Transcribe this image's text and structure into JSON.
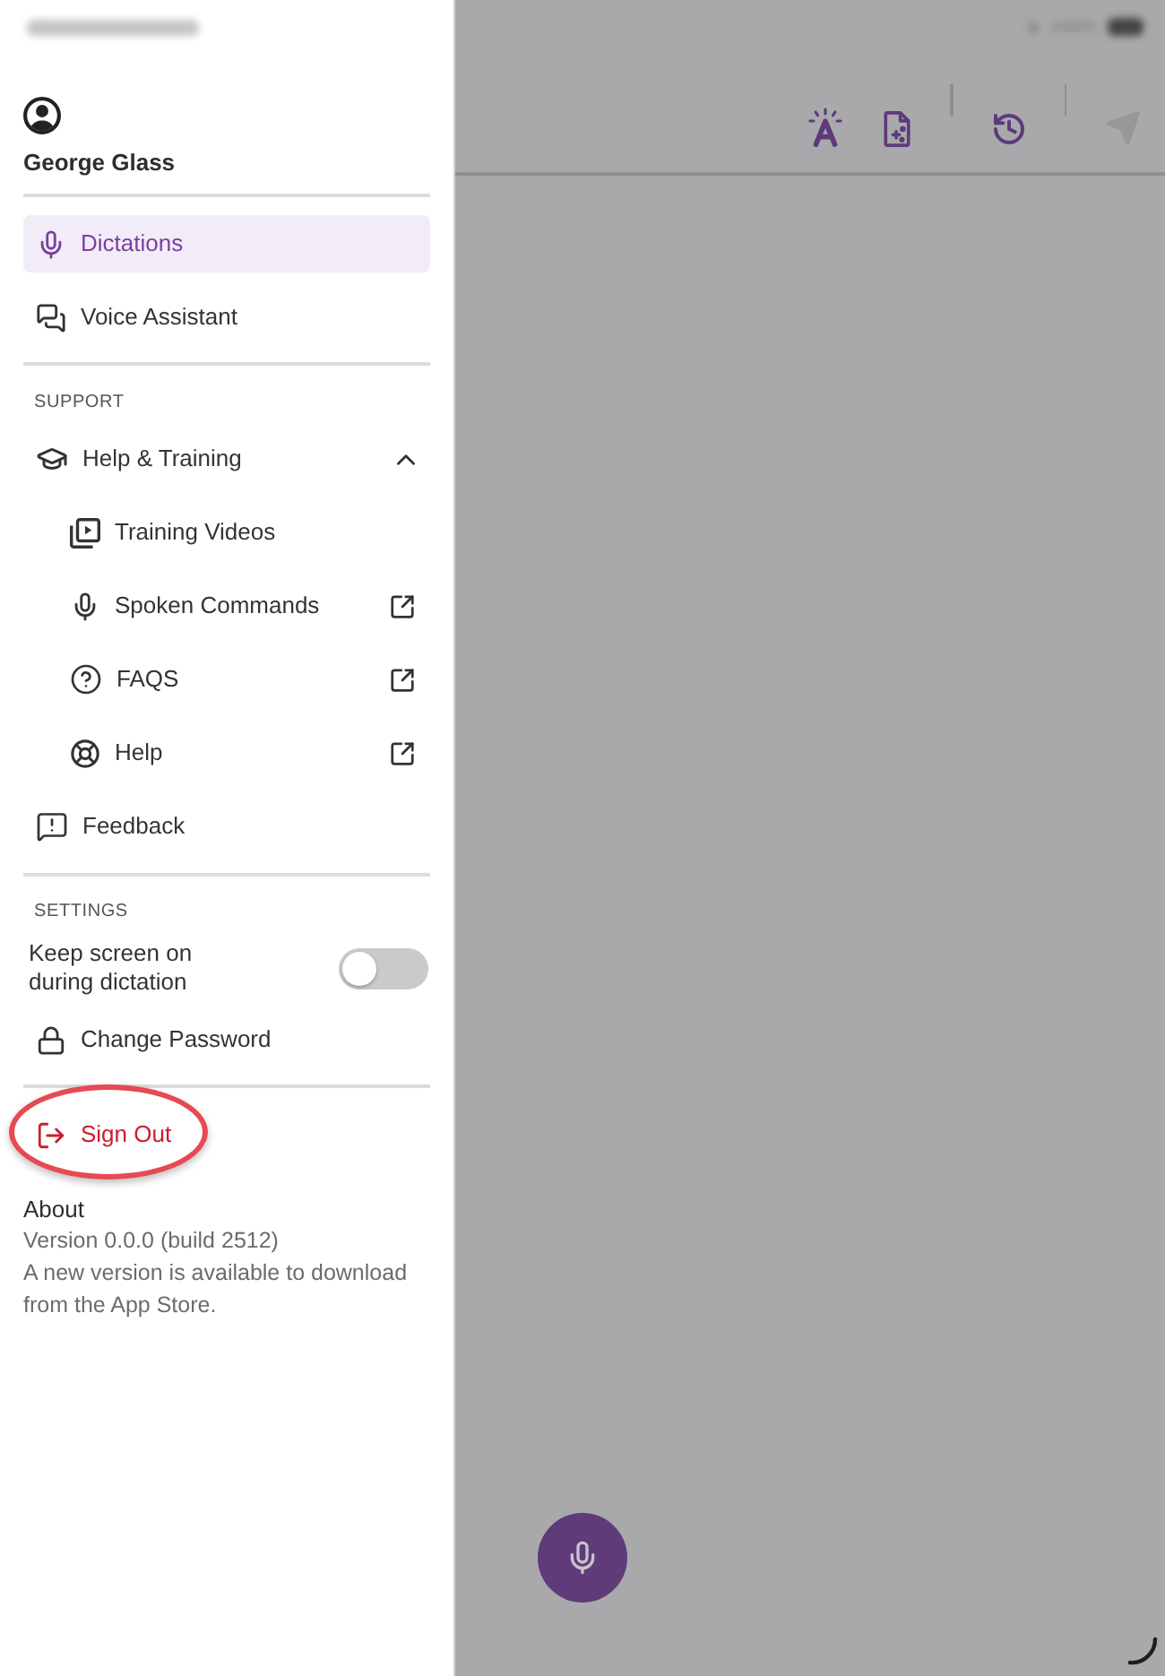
{
  "sidebar": {
    "user": {
      "name": "George Glass"
    },
    "nav": [
      {
        "label": "Dictations",
        "selected": true
      },
      {
        "label": "Voice Assistant",
        "selected": false
      }
    ],
    "support": {
      "heading": "SUPPORT",
      "items": [
        {
          "kind": "group",
          "label": "Help & Training",
          "expanded": true,
          "children": [
            {
              "kind": "internal",
              "label": "Training Videos"
            },
            {
              "kind": "external",
              "label": "Spoken Commands"
            },
            {
              "kind": "external",
              "label": "FAQS"
            },
            {
              "kind": "external",
              "label": "Help"
            }
          ]
        },
        {
          "kind": "item",
          "label": "Feedback"
        }
      ]
    },
    "settings": {
      "heading": "SETTINGS",
      "items": [
        {
          "kind": "toggle",
          "label": "Keep screen on during dictation",
          "on": false
        },
        {
          "kind": "item",
          "label": "Change Password"
        }
      ]
    },
    "sign_out": {
      "label": "Sign Out",
      "highlighted": true
    },
    "about": {
      "title": "About",
      "version": "Version 0.0.0 (build 2512)",
      "notice": "A new version is available to download from the App Store."
    }
  },
  "toolbar": [
    {
      "disabled": false
    },
    {
      "disabled": false
    },
    {
      "disabled": false
    },
    {
      "disabled": true
    }
  ]
}
